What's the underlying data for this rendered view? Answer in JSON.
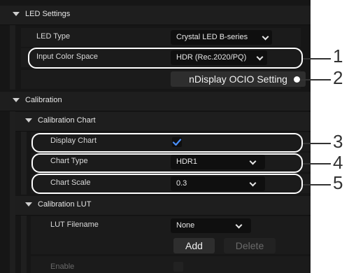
{
  "sections": {
    "led_settings": "LED Settings",
    "calibration": "Calibration",
    "calibration_chart": "Calibration Chart",
    "calibration_lut": "Calibration LUT"
  },
  "led_type": {
    "label": "LED Type",
    "value": "Crystal LED B-series"
  },
  "input_color_space": {
    "label": "Input Color Space",
    "value": "HDR (Rec.2020/PQ)"
  },
  "ndisplay_button": "nDisplay OCIO Setting",
  "display_chart": {
    "label": "Display Chart",
    "checked": true
  },
  "chart_type": {
    "label": "Chart Type",
    "value": "HDR1"
  },
  "chart_scale": {
    "label": "Chart Scale",
    "value": "0.3"
  },
  "lut_filename": {
    "label": "LUT Filename",
    "value": "None"
  },
  "add_button": "Add",
  "delete_button": "Delete",
  "enable": {
    "label": "Enable"
  },
  "callouts": [
    "1",
    "2",
    "3",
    "4",
    "5"
  ],
  "colors": {
    "accent": "#4a90ff",
    "panel": "#161616",
    "callout": "#ffffff"
  }
}
